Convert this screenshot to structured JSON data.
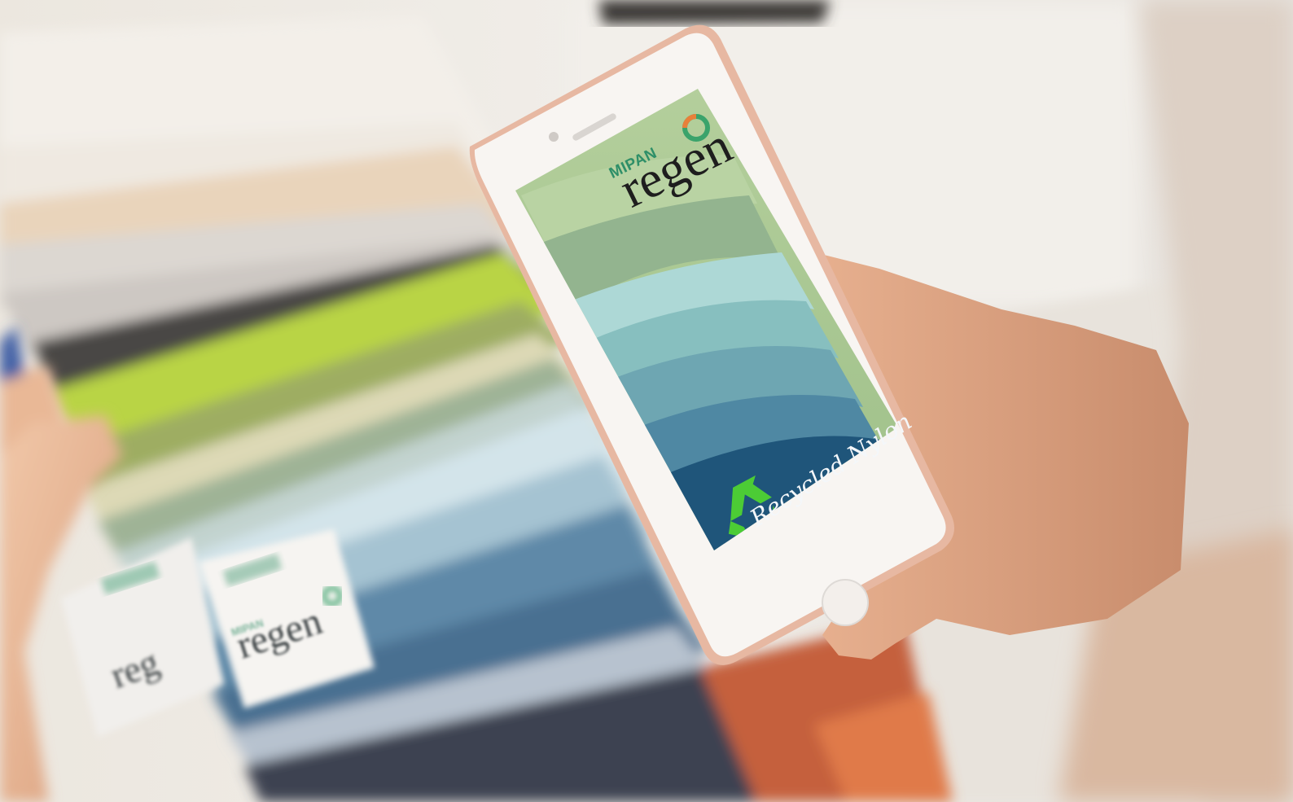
{
  "phone": {
    "app_brand_small": "MIPAN",
    "app_brand_large": "regen",
    "recycled_label": "Recycled Nylon"
  },
  "tags": {
    "front_brand_small": "MIPAN",
    "front_brand_large": "regen",
    "back_brand_large": "reg"
  },
  "colors": {
    "swatch_sage": "#a7c38d",
    "swatch_mint": "#8ab49a",
    "swatch_aqua": "#a9d6d8",
    "swatch_teal": "#79afb3",
    "swatch_blue": "#4f87a2",
    "swatch_navy": "#1d4f72",
    "recycle_green": "#4ccc35",
    "phone_body": "#f7f3f0",
    "phone_rim": "#e4b6a1"
  }
}
